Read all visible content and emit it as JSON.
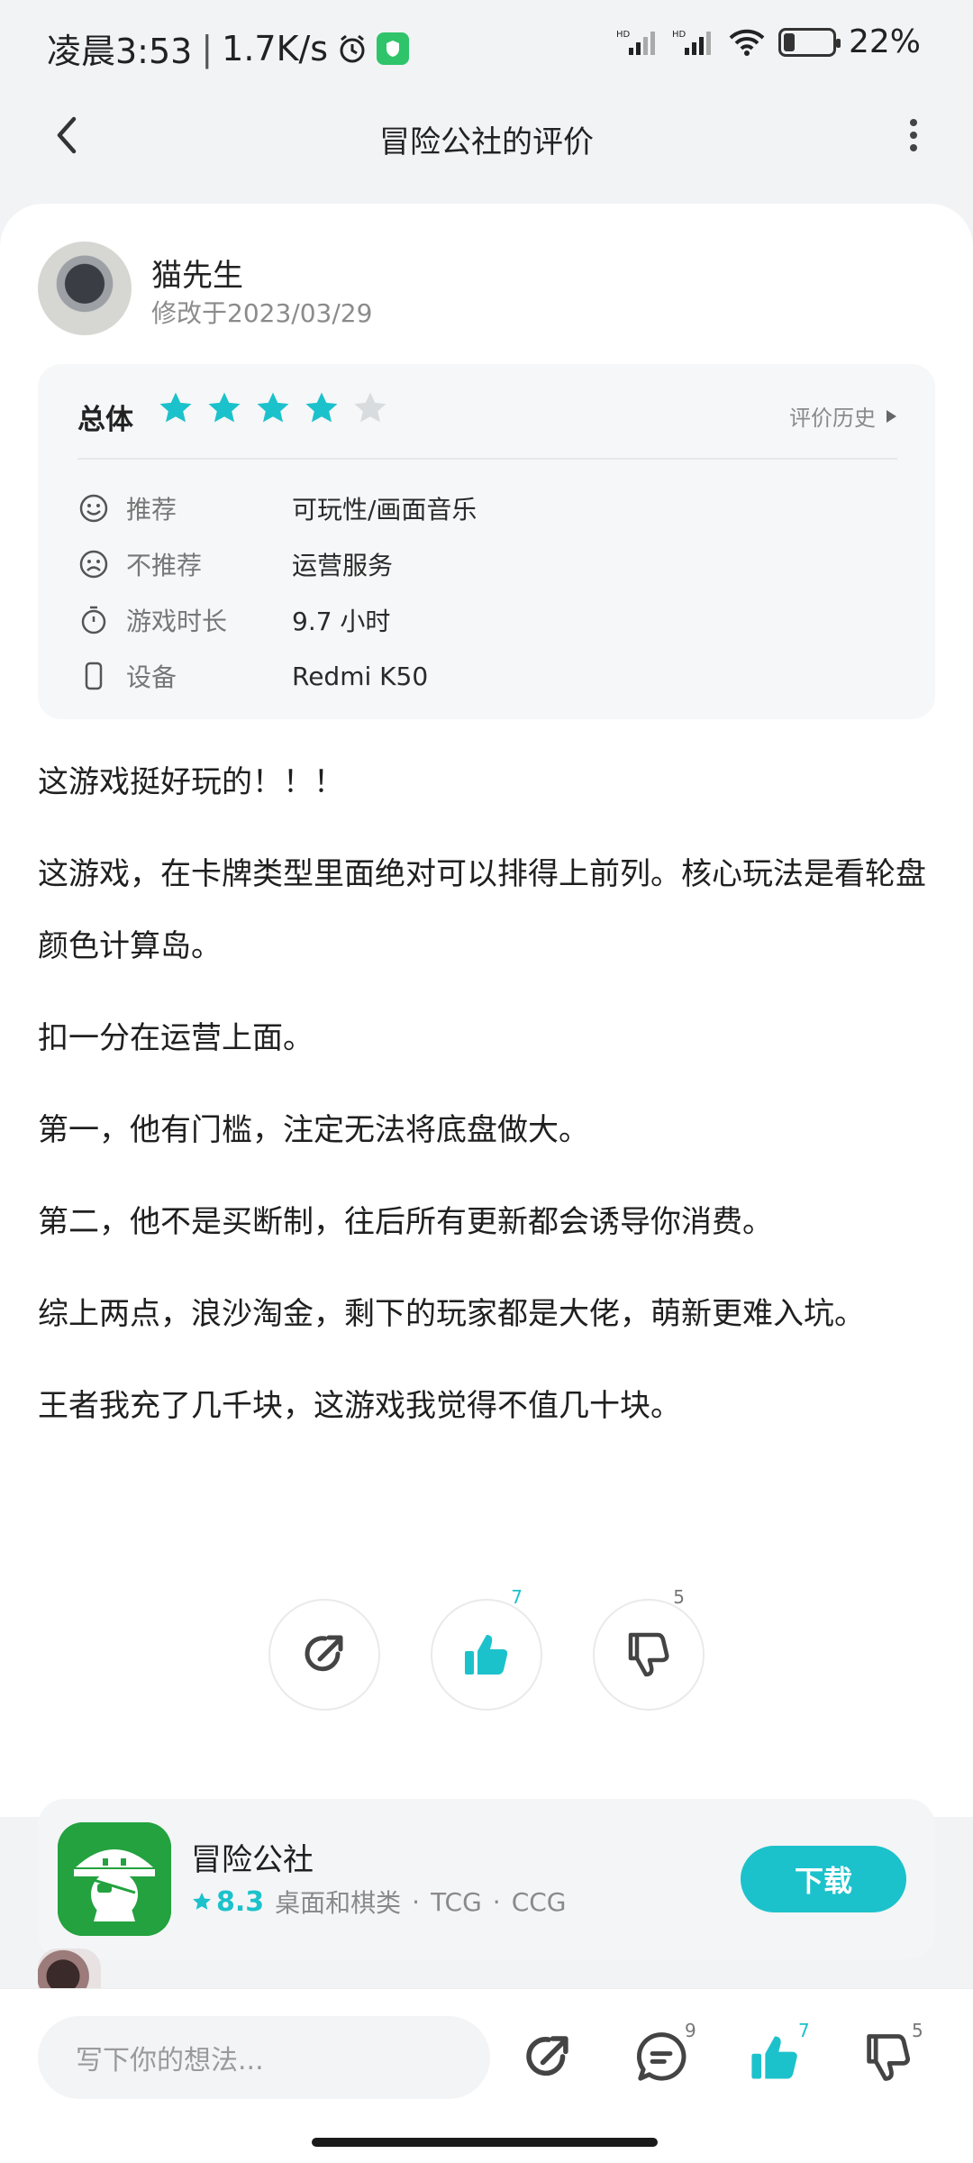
{
  "status_bar": {
    "time": "凌晨3:53",
    "speed": "1.7K/s",
    "battery": "22%"
  },
  "header": {
    "title": "冒险公社的评价"
  },
  "review": {
    "username": "猫先生",
    "modified": "修改于2023/03/29",
    "overall_label": "总体",
    "rating_stars": 4,
    "rating_max": 5,
    "history_label": "评价历史",
    "attributes": [
      {
        "icon": "smile-icon",
        "key": "推荐",
        "value": "可玩性/画面音乐"
      },
      {
        "icon": "frown-icon",
        "key": "不推荐",
        "value": "运营服务"
      },
      {
        "icon": "timer-icon",
        "key": "游戏时长",
        "value": "9.7 小时"
      },
      {
        "icon": "phone-icon",
        "key": "设备",
        "value": "Redmi K50"
      }
    ],
    "paragraphs": [
      "这游戏挺好玩的！！！",
      "这游戏，在卡牌类型里面绝对可以排得上前列。核心玩法是看轮盘颜色计算岛。",
      "扣一分在运营上面。",
      "第一，他有门槛，注定无法将底盘做大。",
      "第二，他不是买断制，往后所有更新都会诱导你消费。",
      "综上两点，浪沙淘金，剩下的玩家都是大佬，萌新更难入坑。",
      "王者我充了几千块，这游戏我觉得不值几十块。"
    ]
  },
  "actions": {
    "like_count": "7",
    "dislike_count": "5"
  },
  "app": {
    "name": "冒险公社",
    "score": "8.3",
    "tags": [
      "桌面和棋类",
      "TCG",
      "CCG"
    ],
    "download_label": "下载"
  },
  "bottom_bar": {
    "input_placeholder": "写下你的想法...",
    "comment_count": "9",
    "like_count": "7",
    "dislike_count": "5"
  },
  "colors": {
    "accent": "#1cc2cb",
    "star_off": "#d9dcdf"
  }
}
